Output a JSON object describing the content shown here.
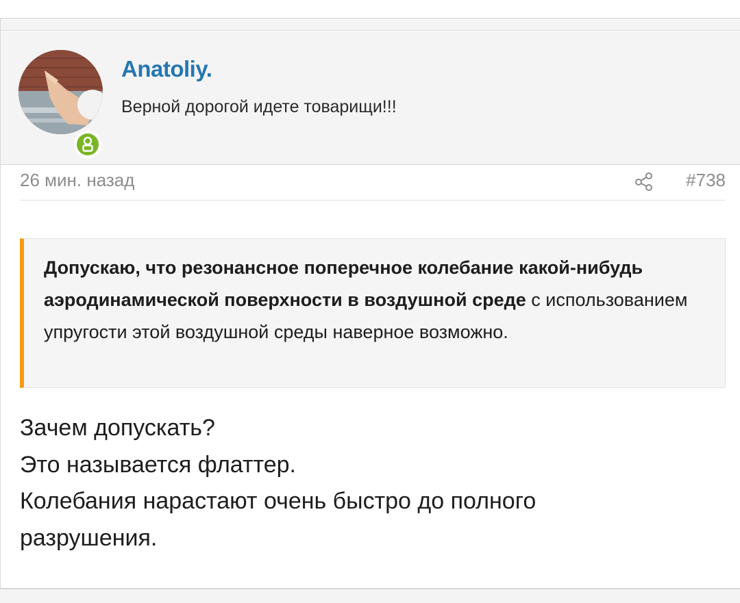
{
  "post": {
    "author": {
      "name": "Anatoliy.",
      "title": "Верной дорогой идете товарищи!!!"
    },
    "time": "26 мин. назад",
    "number": "#738",
    "quote": {
      "bold_text": "Допускаю, что резонансное поперечное колебание какой-нибудь аэродинамической поверхности в воздушной среде",
      "plain_text": " с использованием упругости этой воздушной среды наверное возможно."
    },
    "body_lines": [
      "Зачем допускать?",
      "Это называется флаттер.",
      "Колебания нарастают очень быстро до полного",
      "разрушения."
    ]
  },
  "colors": {
    "username": "#2577b1",
    "quote_border": "#f39c12",
    "online_badge": "#7ab526"
  }
}
